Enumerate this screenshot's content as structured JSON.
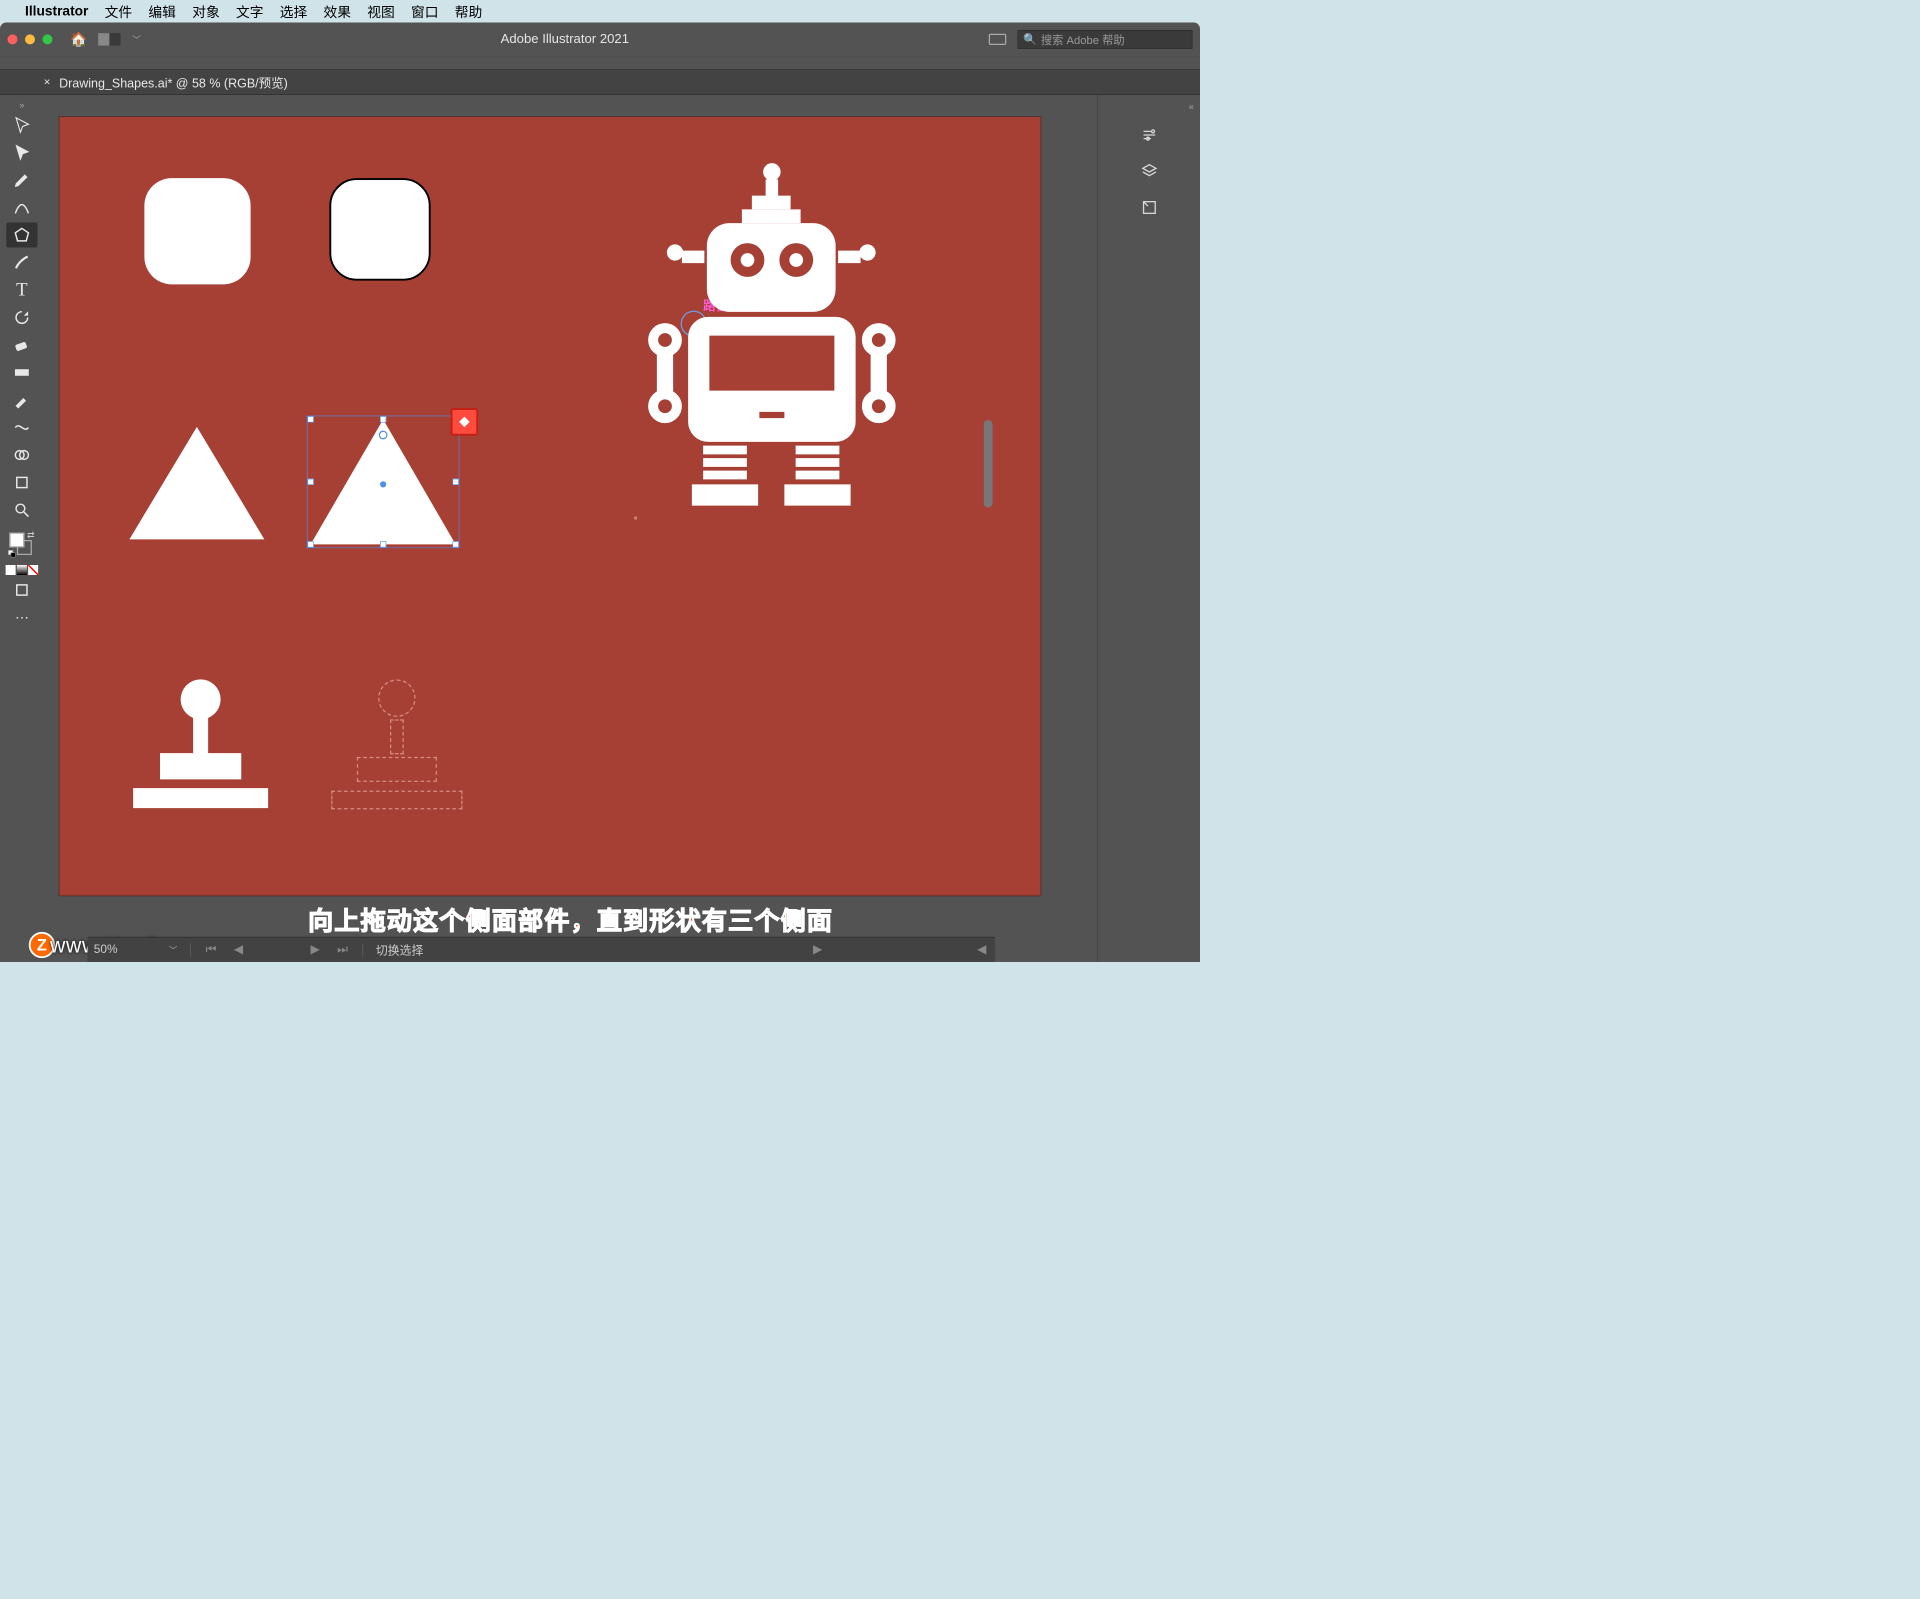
{
  "menubar": {
    "app": "Illustrator",
    "items": [
      "文件",
      "编辑",
      "对象",
      "文字",
      "选择",
      "效果",
      "视图",
      "窗口",
      "帮助"
    ]
  },
  "titlebar": {
    "title": "Adobe Illustrator 2021",
    "search_placeholder": "搜索 Adobe 帮助"
  },
  "doc_tab": {
    "label": "Drawing_Shapes.ai* @ 58 % (RGB/预览)"
  },
  "path_label": "路径",
  "statusbar": {
    "zoom": "50%",
    "mode": "切换选择"
  },
  "caption": "向上拖动这个侧面部件，直到形状有三个侧面",
  "watermark": "www.MacZ.com",
  "watermark_badge": "Z",
  "tools": [
    {
      "name": "selection-tool",
      "active": false
    },
    {
      "name": "direct-selection-tool",
      "active": false
    },
    {
      "name": "pen-tool",
      "active": false
    },
    {
      "name": "curvature-tool",
      "active": false
    },
    {
      "name": "polygon-tool",
      "active": true
    },
    {
      "name": "brush-tool",
      "active": false
    },
    {
      "name": "type-tool",
      "active": false
    },
    {
      "name": "rotate-tool",
      "active": false
    },
    {
      "name": "eraser-tool",
      "active": false
    },
    {
      "name": "gradient-tool",
      "active": false
    },
    {
      "name": "eyedropper-tool",
      "active": false
    },
    {
      "name": "width-tool",
      "active": false
    },
    {
      "name": "shape-builder-tool",
      "active": false
    },
    {
      "name": "artboard-tool",
      "active": false
    },
    {
      "name": "zoom-tool",
      "active": false
    }
  ],
  "right_panels": [
    {
      "name": "properties-panel-icon"
    },
    {
      "name": "layers-panel-icon"
    },
    {
      "name": "libraries-panel-icon"
    }
  ]
}
